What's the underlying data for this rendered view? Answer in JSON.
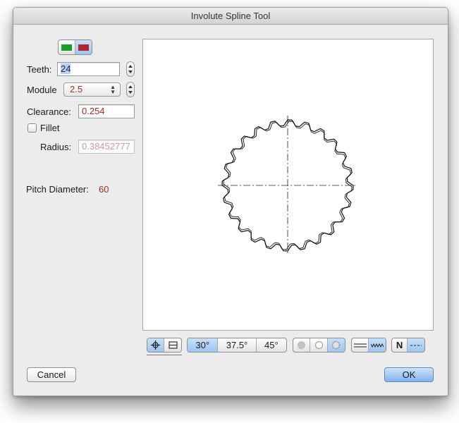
{
  "window": {
    "title": "Involute Spline Tool"
  },
  "color_toggle": {
    "left_color": "#1e9c2a",
    "right_color": "#b3262e"
  },
  "teeth": {
    "label": "Teeth:",
    "value": "24"
  },
  "module": {
    "label": "Module",
    "value": "2.5"
  },
  "clearance": {
    "label": "Clearance:",
    "value": "0.254"
  },
  "fillet": {
    "label": "Fillet",
    "checked": false
  },
  "radius": {
    "label": "Radius:",
    "value": "0.38452777"
  },
  "pitch_diameter": {
    "label": "Pitch Diameter:",
    "value": "60"
  },
  "preview": {
    "teeth_count": 24,
    "pitch_radius_ratio": 0.82
  },
  "toolbar": {
    "view_mode": {
      "icons": [
        "crosshair-icon",
        "section-icon"
      ],
      "selected": 0
    },
    "pressure_angles": {
      "options": [
        "30°",
        "37.5°",
        "45°"
      ],
      "selected": 0
    },
    "fit_type": {
      "icons": [
        "gear-small-icon",
        "circle-icon",
        "gear-outline-icon"
      ],
      "selected": 2
    },
    "profile": {
      "icons": [
        "straight-lines-icon",
        "zigzag-icon"
      ],
      "selected": 1
    },
    "spec": {
      "label": "N",
      "icon": "dash-line-icon",
      "selected": 1
    }
  },
  "buttons": {
    "cancel": "Cancel",
    "ok": "OK"
  },
  "colors": {
    "value_text": "#a32d1c",
    "accent": "#7fb3ec"
  }
}
